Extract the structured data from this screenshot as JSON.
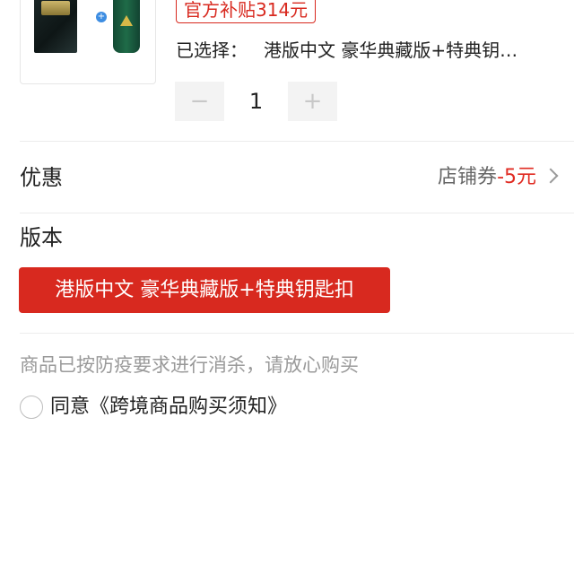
{
  "product": {
    "subsidy_badge": "官方补贴314元",
    "selected_prefix": "已选择：",
    "selected_value": "港版中文 豪华典藏版+特典钥…"
  },
  "quantity": {
    "minus": "−",
    "value": "1",
    "plus": "+"
  },
  "discount": {
    "label": "优惠",
    "coupon_prefix": "店铺券",
    "coupon_amount": "-5元"
  },
  "version": {
    "label": "版本",
    "selected_option": "港版中文 豪华典藏版+特典钥匙扣"
  },
  "notice": "商品已按防疫要求进行消杀，请放心购买",
  "agreement": {
    "text": "同意《跨境商品购买须知》"
  },
  "colors": {
    "accent": "#d8291f",
    "muted_text": "#9a9a9a"
  }
}
